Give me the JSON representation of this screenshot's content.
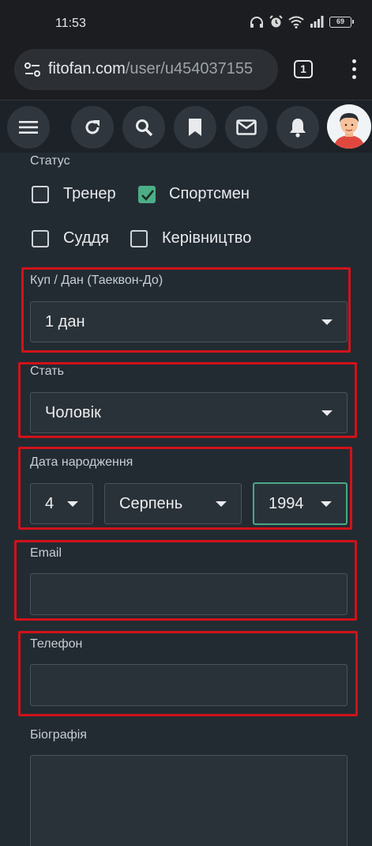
{
  "status_bar": {
    "time": "11:53",
    "battery": "69"
  },
  "browser": {
    "url_domain": "fitofan.com",
    "url_path": "/user/u454037155",
    "tab_count": "1"
  },
  "form": {
    "status_label": "Статус",
    "roles": [
      {
        "label": "Тренер",
        "checked": false
      },
      {
        "label": "Спортсмен",
        "checked": true
      },
      {
        "label": "Суддя",
        "checked": false
      },
      {
        "label": "Керівництво",
        "checked": false
      }
    ],
    "rank": {
      "label": "Куп / Дан (Таеквон-До)",
      "value": "1 дан"
    },
    "gender": {
      "label": "Стать",
      "value": "Чоловік"
    },
    "birth_date": {
      "label": "Дата народження",
      "day": "4",
      "month": "Серпень",
      "year": "1994"
    },
    "email": {
      "label": "Email",
      "value": ""
    },
    "phone": {
      "label": "Телефон",
      "value": ""
    },
    "bio": {
      "label": "Біографія",
      "value": ""
    }
  },
  "colors": {
    "accent_check": "#4cae86",
    "highlight_border": "#d0121a",
    "form_background": "#232b32"
  }
}
